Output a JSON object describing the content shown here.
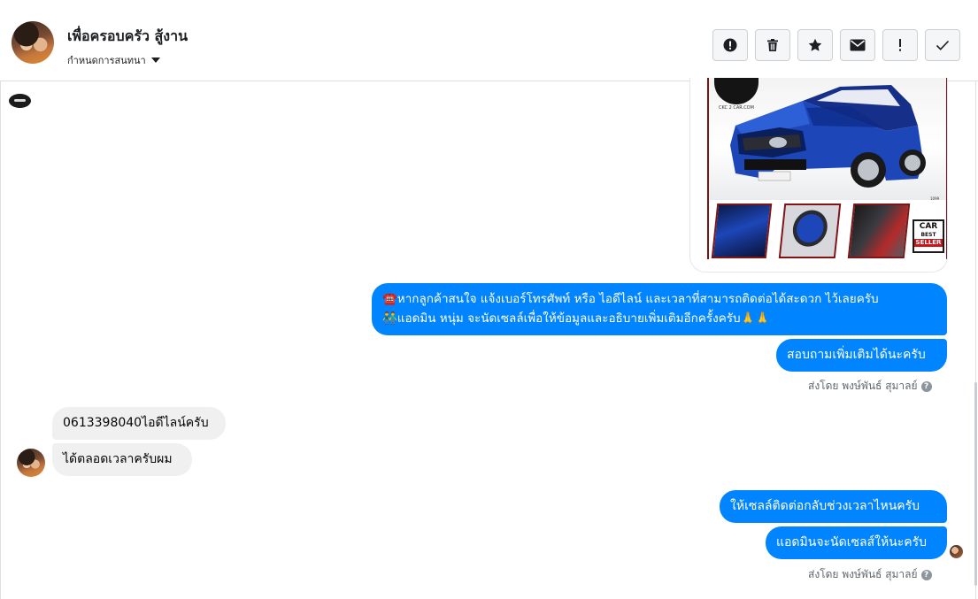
{
  "header": {
    "contact_name": "เพื่อครอบครัว สู้งาน",
    "subtitle": "กำหนดการสนทนา",
    "actions": [
      {
        "name": "report-button",
        "icon": "alert-circle-icon"
      },
      {
        "name": "delete-button",
        "icon": "trash-icon"
      },
      {
        "name": "star-button",
        "icon": "star-icon"
      },
      {
        "name": "mark-unread-button",
        "icon": "envelope-icon"
      },
      {
        "name": "mark-important-button",
        "icon": "exclamation-icon"
      },
      {
        "name": "mark-done-button",
        "icon": "checkmark-icon"
      }
    ]
  },
  "poster": {
    "logo_text": "CKC 2 CAR.COM",
    "badge_line1": "CAR",
    "badge_line2": "BEST",
    "badge_line3": "SELLER",
    "plate": "1099"
  },
  "messages": {
    "out_long_line1": "☎️หากลูกค้าสนใจ แจ้งเบอร์โทรศัพท์ หรือ ไอดีไลน์ และเวลาที่สามารถติดต่อได้สะดวก ไว้เลยครับ",
    "out_long_line2": "👬แอดมิน หนุ่ม จะนัดเซลล์เพื่อให้ข้อมูลและอธิบายเพิ่มเติมอีกครั้งครับ🙏🙏",
    "out_short_1": "สอบถามเพิ่มเติมได้นะครับ",
    "sent_by_1": "ส่งโดย พงษ์พันธ์ สุมาลย์",
    "in_1": "0613398040ไอดีไลน์ครับ",
    "in_2": "ได้ตลอดเวลาครับผม",
    "out_short_2": "ให้เซลล์ติดต่อกลับช่วงเวลาไหนครับ",
    "out_short_3": "แอดมินจะนัดเซลส์ให้นะครับ",
    "sent_by_2": "ส่งโดย พงษ์พันธ์ สุมาลย์"
  },
  "colors": {
    "outgoing_bubble": "#0084ff",
    "incoming_bubble": "#f0f0f0",
    "poster_border": "#7d1416",
    "car_blue": "#1d46b8"
  }
}
